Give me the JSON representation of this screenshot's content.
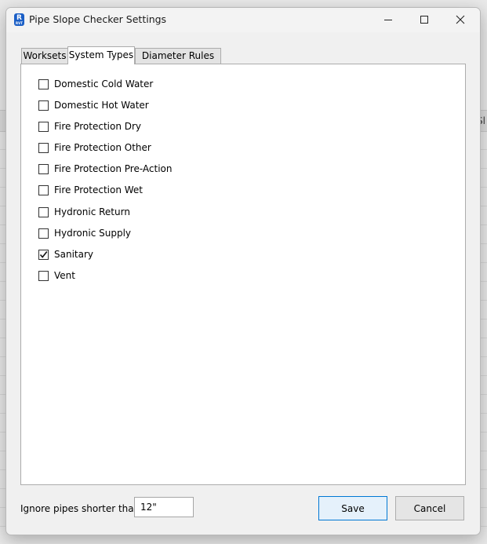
{
  "window": {
    "title": "Pipe Slope Checker Settings",
    "app_icon_letter": "R",
    "app_icon_sub": "RVT"
  },
  "tabs": [
    {
      "label": "Worksets",
      "active": false
    },
    {
      "label": "System Types",
      "active": true
    },
    {
      "label": "Diameter Rules",
      "active": false
    }
  ],
  "system_types": [
    {
      "label": "Domestic Cold Water",
      "checked": false
    },
    {
      "label": "Domestic Hot Water",
      "checked": false
    },
    {
      "label": "Fire Protection Dry",
      "checked": false
    },
    {
      "label": "Fire Protection Other",
      "checked": false
    },
    {
      "label": "Fire Protection Pre-Action",
      "checked": false
    },
    {
      "label": "Fire Protection Wet",
      "checked": false
    },
    {
      "label": "Hydronic Return",
      "checked": false
    },
    {
      "label": "Hydronic Supply",
      "checked": false
    },
    {
      "label": "Sanitary",
      "checked": true
    },
    {
      "label": "Vent",
      "checked": false
    }
  ],
  "footer": {
    "ignore_label": "Ignore pipes shorter than:",
    "ignore_value": "12\"",
    "save_label": "Save",
    "cancel_label": "Cancel"
  },
  "background": {
    "partial_header_text": "Sl"
  },
  "colors": {
    "accent": "#0078d4",
    "app_icon": "#1b5fc6"
  }
}
